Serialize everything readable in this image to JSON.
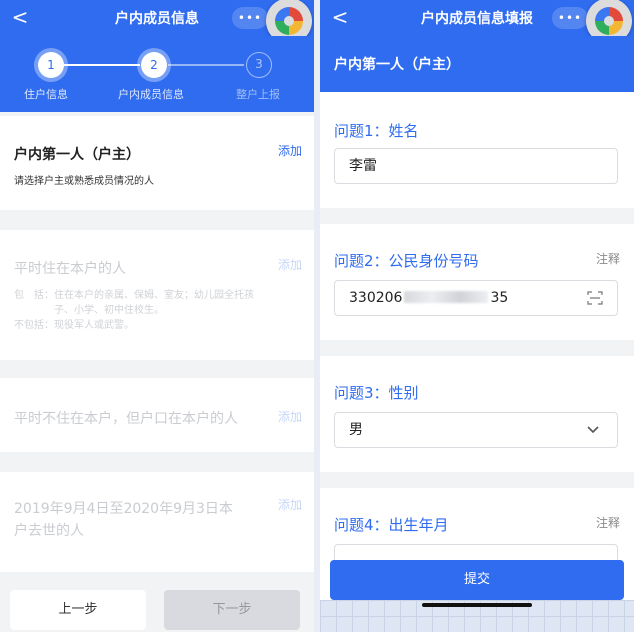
{
  "left": {
    "title": "户内成员信息",
    "back_glyph": "<",
    "capsule_glyph": "•••",
    "steps": [
      {
        "num": "1",
        "label": "住户信息"
      },
      {
        "num": "2",
        "label": "户内成员信息"
      },
      {
        "num": "3",
        "label": "整户上报"
      }
    ],
    "cards": [
      {
        "title": "户内第一人（户主）",
        "sub": "请选择户主或熟悉成员情况的人",
        "add": "添加"
      },
      {
        "title": "平时住在本户的人",
        "sub1": "包　括：住在本户的亲属、保姆、室友；幼儿园全托孩",
        "sub2": "　　　　子、小学、初中住校生。",
        "sub3": "不包括：现役军人或武警。",
        "add": "添加"
      },
      {
        "title": "平时不住在本户，但户口在本户的人",
        "add": "添加"
      },
      {
        "title1": "2019年9月4日至2020年9月3日本",
        "title2": "户去世的人",
        "add": "添加"
      }
    ],
    "prev_label": "上一步",
    "next_label": "下一步"
  },
  "right": {
    "title": "户内成员信息填报",
    "back_glyph": "<",
    "capsule_glyph": "•••",
    "section_title": "户内第一人（户主）",
    "questions": [
      {
        "label": "问题1：姓名",
        "value": "李雷"
      },
      {
        "label": "问题2：公民身份号码",
        "note": "注释",
        "value_prefix": "330206",
        "value_suffix": "35"
      },
      {
        "label": "问题3：性别",
        "value": "男"
      },
      {
        "label": "问题4：出生年月",
        "note": "注释"
      }
    ],
    "submit_label": "提交"
  },
  "colors": {
    "primary": "#2f6cf0",
    "background": "#f2f3f5"
  },
  "icons": [
    "back-arrow-icon",
    "more-icon",
    "app-logo-icon",
    "scan-icon",
    "chevron-down-icon"
  ]
}
